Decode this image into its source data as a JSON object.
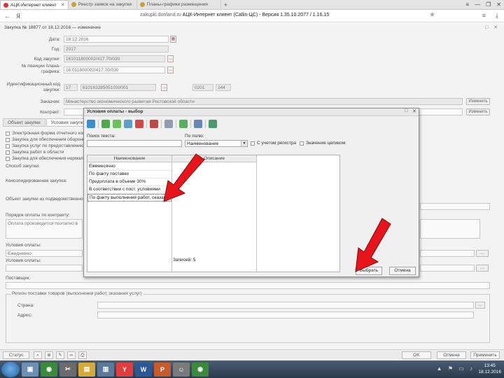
{
  "browser": {
    "tabs": [
      {
        "label": "АЦК-Интернет клиент",
        "active": true
      },
      {
        "label": "Реестр заявок на закупки",
        "active": false
      },
      {
        "label": "Планы-графики размещения",
        "active": false
      }
    ],
    "new_tab": "+",
    "nav_back": "←",
    "ya_logo": "Я",
    "url_domain": "zakupki.donland.ru",
    "url_title": "АЦК-Интернет клиент (Callin-ЦС) - Версия 1.35.10.2077 / 1.16.15",
    "window_controls": [
      "≡",
      "—",
      "❐",
      "✕"
    ],
    "star": "★",
    "menu": "≡",
    "download": "⤓"
  },
  "app": {
    "title": "Закупка № 18877 от 18.12.2016 — изменение",
    "window_controls": "□ ✕",
    "fields": {
      "date_label": "Дата:",
      "date_value": "18.12.2016",
      "year_label": "Год:",
      "year_value": "2017",
      "code_label": "Код закупки:",
      "code_value": "161011800002/417.70/030",
      "plan_label": "№ позиции плана-графика:",
      "plan_value": "16.011800002/417.70/030",
      "ikz_label": "Идентификационный код закупки:",
      "ikz_part1": "17",
      "ikz_part2": "610163285051030001",
      "ikz_part3": "0201",
      "ikz_part4": "244",
      "customer_label": "Заказчик:",
      "customer_value": "Министерство экономического развития Ростовской области",
      "contract_label": "Контракт:",
      "change_btn": "Изменить"
    },
    "subtabs": [
      {
        "label": "Объект закупки",
        "active": false
      },
      {
        "label": "Условия закупки",
        "active": true
      }
    ],
    "checkboxes": [
      "Электронная форма отчетного контракта",
      "Закупка для обеспечения обороны",
      "Закупка услуг по предоставлению",
      "Закупка работ в области",
      "Закупка для обеспечения нормального"
    ],
    "purchase_method_label": "Способ закупки:",
    "combined_label": "Консолидированная закупка:",
    "subject_label": "Объект закупки из подведомственного:",
    "payment_order_label": "Порядок оплаты по контракту:",
    "payment_order_value": "Оплата производится поэтапно в",
    "payment_terms_label": "Условия оплаты:",
    "payment_terms_value": "Ежедневно",
    "payment_cond_label": "Условия оплаты:",
    "supply_label": "Поставщик:",
    "group_title": "Регион поставки товаров (выполнения работ, оказания услуг)",
    "country_label": "Страна:",
    "address_label": "Адрес:",
    "bottom_buttons": {
      "status": "Статус",
      "ok": "OK",
      "cancel": "Отмена",
      "apply": "Применить"
    }
  },
  "dialog": {
    "title": "Условия оплаты - выбор",
    "controls": [
      "□",
      "✕"
    ],
    "search_label": "Поиск текста:",
    "search_value": "",
    "field_label": "По полю:",
    "field_value": "Наименование",
    "case_label": "С учетом регистра",
    "whole_label": "Значение целиком",
    "columns": [
      "Наименование",
      "Описание"
    ],
    "rows": [
      "Ежемесячно",
      "По факту поставки",
      "Предоплата в объеме 30%",
      "В соответствии с пост. условиями",
      "По факту выполнения работ, оказания услуг"
    ],
    "selected_row": 4,
    "count_label": "Записей: 5",
    "select_btn": "Выбрать",
    "cancel_btn": "Отмена"
  },
  "taskbar": {
    "apps": [
      {
        "name": "explorer-app",
        "color": "#6c8fb6",
        "glyph": "▣"
      },
      {
        "name": "chrome-app",
        "color": "#3c8a3c",
        "glyph": "◉"
      },
      {
        "name": "tools-app",
        "color": "#6b6b6b",
        "glyph": "✂"
      },
      {
        "name": "folder-app",
        "color": "#d9a93a",
        "glyph": "▤"
      },
      {
        "name": "files-app",
        "color": "#5a7a9a",
        "glyph": "▥"
      },
      {
        "name": "yandex-app",
        "color": "#e33c3c",
        "glyph": "Y"
      },
      {
        "name": "word-app",
        "color": "#2b5797",
        "glyph": "W"
      },
      {
        "name": "powerpoint-app",
        "color": "#c85a2b",
        "glyph": "P"
      },
      {
        "name": "user-app",
        "color": "#7a7a7a",
        "glyph": "☺"
      },
      {
        "name": "chrome2-app",
        "color": "#3c8a3c",
        "glyph": "◉"
      }
    ],
    "time": "13:45",
    "date": "18.12.2016"
  }
}
